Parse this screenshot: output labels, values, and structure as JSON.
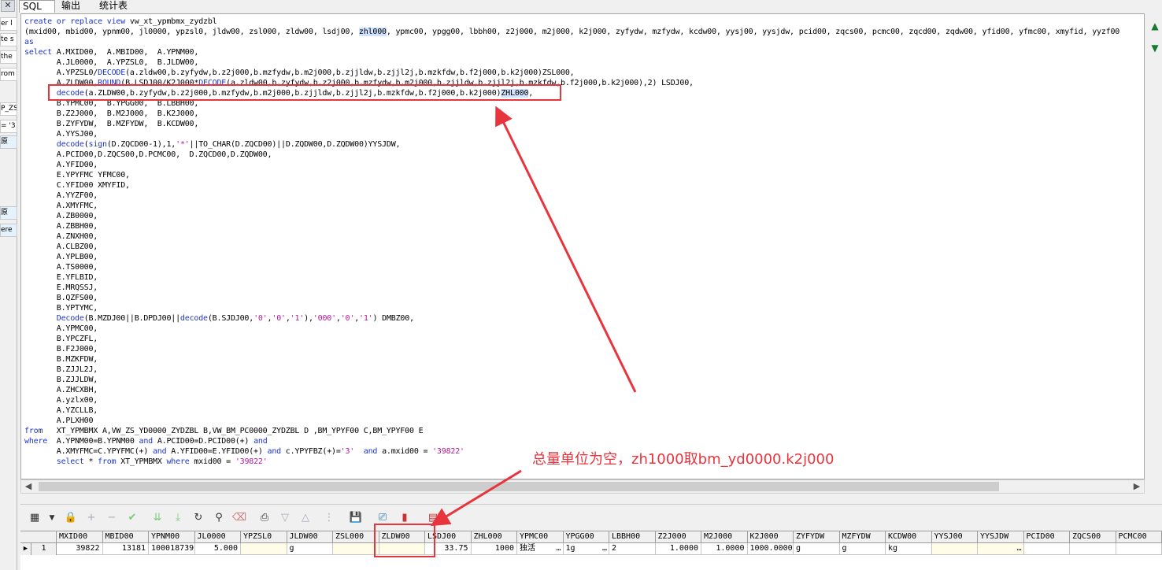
{
  "tabs": [
    {
      "label": "SQL"
    },
    {
      "label": "输出"
    },
    {
      "label": "统计表"
    }
  ],
  "left_fragments": [
    "er l",
    "te s",
    "the",
    "rom",
    "P_ZS",
    "= '3",
    "原",
    "原",
    "ere"
  ],
  "sql_lines": [
    [
      {
        "t": "create or replace view",
        "c": "kw"
      },
      {
        "t": " vw_xt_ypmbmx_zydzbl"
      }
    ],
    [
      {
        "t": "(mxid00, mbid00, ypnm00, jl0000, ypzsl0, jldw00, zsl000, zldw00, lsdj00, "
      },
      {
        "t": "zhl000",
        "c": "hl"
      },
      {
        "t": ", ypmc00, ypgg00, lbbh00, z2j000, m2j000, k2j000, zyfydw, mzfydw, kcdw00, yysj00, yysjdw, pcid00, zqcs00, pcmc00, zqcd00, zqdw00, yfid00, yfmc00, xmyfid, yyzf00"
      }
    ],
    [
      {
        "t": "as",
        "c": "kw"
      }
    ],
    [
      {
        "t": "select",
        "c": "kw"
      },
      {
        "t": " A.MXID00,  A.MBID00,  A.YPNM00,"
      }
    ],
    [
      {
        "t": "       A.JL0000,  A.YPZSL0,  B.JLDW00,"
      }
    ],
    [
      {
        "t": "       A.YPZSL0/"
      },
      {
        "t": "DECODE",
        "c": "fn"
      },
      {
        "t": "(a.zldw00,b.zyfydw,b.z2j000,b.mzfydw,b.m2j000,b.zjjldw,b.zjjl2j,b.mzkfdw,b.f2j000,b.k2j000)ZSL000,"
      }
    ],
    [
      {
        "t": "       A.ZLDW00,"
      },
      {
        "t": "ROUND",
        "c": "fn"
      },
      {
        "t": "(B.LSDJ00/K2J000*"
      },
      {
        "t": "DECODE",
        "c": "fn"
      },
      {
        "t": "(a.zldw00,b.zyfydw,b.z2j000,b.mzfydw,b.m2j000,b.zjjldw,b.zjjl2j,b.mzkfdw,b.f2j000,b.k2j000),2) LSDJ00,"
      }
    ],
    [
      {
        "t": "       "
      },
      {
        "t": "decode",
        "c": "fn"
      },
      {
        "t": "(a.ZLDW00,b.zyfydw,b.z2j000,b.mzfydw,b.m2j000,b.zjjldw,b.zjjl2j,b.mzkfdw,b.f2j000,b.k2j000)"
      },
      {
        "t": "ZHL000",
        "c": "hl"
      },
      {
        "t": ","
      }
    ],
    [
      {
        "t": "       B.YPMC00,  B.YPGG00,  B.LBBH00,"
      }
    ],
    [
      {
        "t": "       B.Z2J000,  B.M2J000,  B.K2J000,"
      }
    ],
    [
      {
        "t": "       B.ZYFYDW,  B.MZFYDW,  B.KCDW00,"
      }
    ],
    [
      {
        "t": "       A.YYSJ00,"
      }
    ],
    [
      {
        "t": "       "
      },
      {
        "t": "decode",
        "c": "fn"
      },
      {
        "t": "("
      },
      {
        "t": "sign",
        "c": "fn"
      },
      {
        "t": "(D.ZQCD00-1),1,"
      },
      {
        "t": "'*'",
        "c": "str"
      },
      {
        "t": "||TO_CHAR(D.ZQCD00)||D.ZQDW00,D.ZQDW00)YYSJDW,"
      }
    ],
    [
      {
        "t": "       A.PCID00,D.ZQCS00,D.PCMC00,  D.ZQCD00,D.ZQDW00,"
      }
    ],
    [
      {
        "t": "       A.YFID00,"
      }
    ],
    [
      {
        "t": "       E.YPYFMC YFMC00,"
      }
    ],
    [
      {
        "t": "       C.YFID00 XMYFID,"
      }
    ],
    [
      {
        "t": "       A.YYZF00,"
      }
    ],
    [
      {
        "t": "       A.XMYFMC,"
      }
    ],
    [
      {
        "t": "       A.ZB0000,"
      }
    ],
    [
      {
        "t": "       A.ZBBH00,"
      }
    ],
    [
      {
        "t": "       A.ZNXH00,"
      }
    ],
    [
      {
        "t": "       A.CLBZ00,"
      }
    ],
    [
      {
        "t": "       A.YPLB00,"
      }
    ],
    [
      {
        "t": "       A.TS0000,"
      }
    ],
    [
      {
        "t": "       E.YFLBID,"
      }
    ],
    [
      {
        "t": "       E.MRQSSJ,"
      }
    ],
    [
      {
        "t": "       B.QZFS00,"
      }
    ],
    [
      {
        "t": "       B.YPTYMC,"
      }
    ],
    [
      {
        "t": "       "
      },
      {
        "t": "Decode",
        "c": "fn"
      },
      {
        "t": "(B.MZDJ00||B.DPDJ00||"
      },
      {
        "t": "decode",
        "c": "fn"
      },
      {
        "t": "(B.SJDJ00,"
      },
      {
        "t": "'0'",
        "c": "str"
      },
      {
        "t": ","
      },
      {
        "t": "'0'",
        "c": "str"
      },
      {
        "t": ","
      },
      {
        "t": "'1'",
        "c": "str"
      },
      {
        "t": "),"
      },
      {
        "t": "'000'",
        "c": "str"
      },
      {
        "t": ","
      },
      {
        "t": "'0'",
        "c": "str"
      },
      {
        "t": ","
      },
      {
        "t": "'1'",
        "c": "str"
      },
      {
        "t": ") DMBZ00,"
      }
    ],
    [
      {
        "t": "       A.YPMC00,"
      }
    ],
    [
      {
        "t": "       B.YPCZFL,"
      }
    ],
    [
      {
        "t": "       B.F2J000,"
      }
    ],
    [
      {
        "t": "       B.MZKFDW,"
      }
    ],
    [
      {
        "t": "       B.ZJJL2J,"
      }
    ],
    [
      {
        "t": "       B.ZJJLDW,"
      }
    ],
    [
      {
        "t": "       A.ZHCXBH,"
      }
    ],
    [
      {
        "t": "       A.yzlx00,"
      }
    ],
    [
      {
        "t": "       A.YZCLLB,"
      }
    ],
    [
      {
        "t": "       A.PLXH00"
      }
    ],
    [
      {
        "t": "from",
        "c": "kw"
      },
      {
        "t": "   XT_YPMBMX A,VW_ZS_YD0000_ZYDZBL B,VW_BM_PC0000_ZYDZBL D ,BM_YPYF00 C,BM_YPYF00 E"
      }
    ],
    [
      {
        "t": "where",
        "c": "kw"
      },
      {
        "t": "  A.YPNM00=B.YPNM00 "
      },
      {
        "t": "and",
        "c": "kw"
      },
      {
        "t": " A.PCID00=D.PCID00(+) "
      },
      {
        "t": "and",
        "c": "kw"
      }
    ],
    [
      {
        "t": "       A.XMYFMC=C.YPYFMC(+) "
      },
      {
        "t": "and",
        "c": "kw"
      },
      {
        "t": " A.YFID00=E.YFID00(+) "
      },
      {
        "t": "and",
        "c": "kw"
      },
      {
        "t": " c.YPYFBZ(+)="
      },
      {
        "t": "'3'",
        "c": "str"
      },
      {
        "t": "  "
      },
      {
        "t": "and",
        "c": "kw"
      },
      {
        "t": " a.mxid00 = "
      },
      {
        "t": "'39822'",
        "c": "str"
      }
    ],
    [
      {
        "t": "       "
      },
      {
        "t": "select",
        "c": "kw"
      },
      {
        "t": " * "
      },
      {
        "t": "from",
        "c": "kw"
      },
      {
        "t": " XT_YPMBMX "
      },
      {
        "t": "where",
        "c": "kw"
      },
      {
        "t": " mxid00 = "
      },
      {
        "t": "'39822'",
        "c": "str"
      }
    ]
  ],
  "annotation_text": "总量单位为空，zh1000取bm_yd0000.k2j000",
  "grid": {
    "columns": [
      "MXID00",
      "MBID00",
      "YPNM00",
      "JL0000",
      "YPZSL0",
      "JLDW00",
      "ZSL000",
      "ZLDW00",
      "LSDJ00",
      "ZHL000",
      "YPMC00",
      "YPGG00",
      "LBBH00",
      "Z2J000",
      "M2J000",
      "K2J000",
      "ZYFYDW",
      "MZFYDW",
      "KCDW00",
      "YYSJ00",
      "YYSJDW",
      "PCID00",
      "ZQCS00",
      "PCMC00"
    ],
    "row_number": "1",
    "row_marker": "▶",
    "row": [
      "39822",
      "13181",
      "100018739",
      "5.000",
      "",
      "g",
      "",
      "",
      "33.75",
      "1000",
      "独活",
      "1g",
      "2",
      "1.0000",
      "1.0000",
      "1000.0000",
      "g",
      "g",
      "kg",
      "",
      "",
      "",
      "",
      ""
    ],
    "ellipsis": "…"
  },
  "colors": {
    "keyword": "#1e35c8",
    "string": "#b5179e",
    "annotation": "#e8343c",
    "highlight": "#cfe2ff"
  }
}
